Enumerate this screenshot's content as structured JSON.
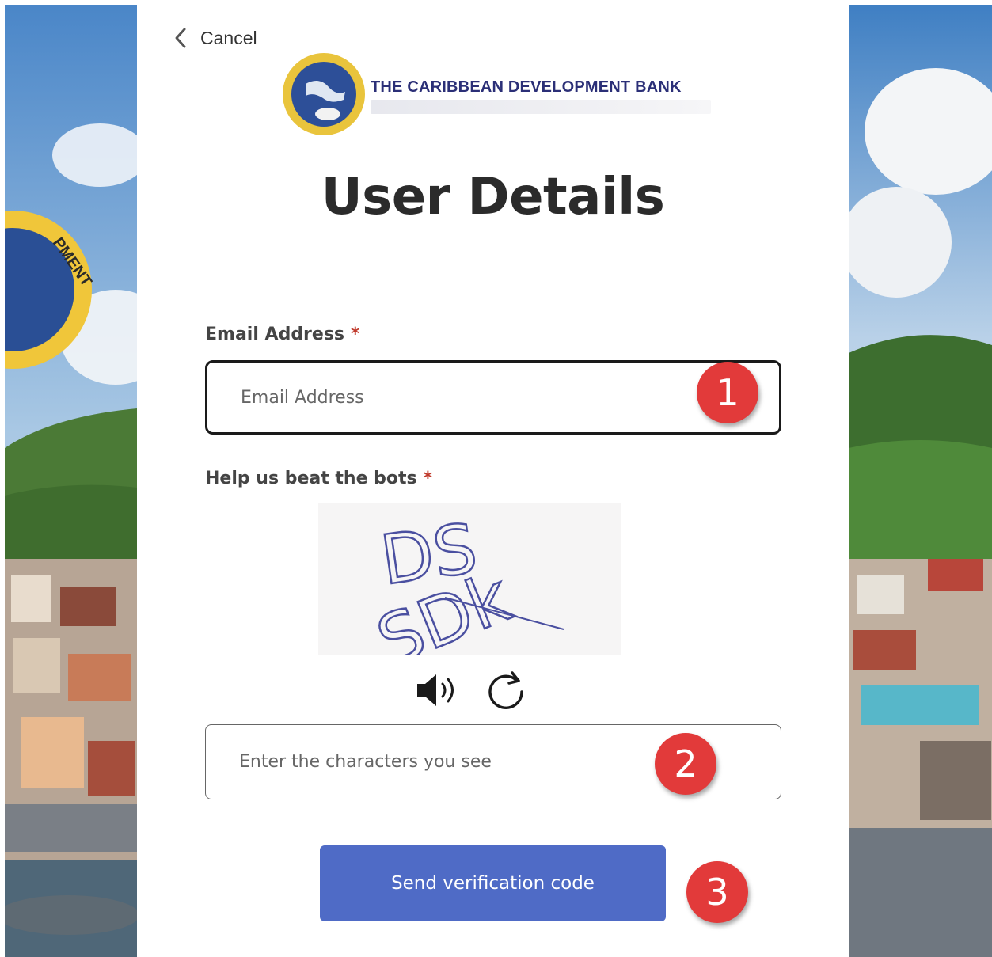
{
  "nav": {
    "cancel_label": "Cancel",
    "back_icon": "chevron-left-icon"
  },
  "logo": {
    "bank_name": "THE CARIBBEAN DEVELOPMENT BANK"
  },
  "page": {
    "title": "User Details"
  },
  "form": {
    "email": {
      "label": "Email Address",
      "required_mark": "*",
      "placeholder": "Email Address"
    },
    "captcha": {
      "label": "Help us beat the bots",
      "required_mark": "*",
      "image_text": "DS SDk",
      "audio_icon": "speaker-icon",
      "refresh_icon": "refresh-icon",
      "input_placeholder": "Enter the characters you see"
    },
    "submit_label": "Send verification code"
  },
  "annotations": {
    "step1": "1",
    "step2": "2",
    "step3": "3",
    "color": "#e23a3a"
  },
  "colors": {
    "button": "#4f6bc6",
    "required": "#c0392b"
  }
}
